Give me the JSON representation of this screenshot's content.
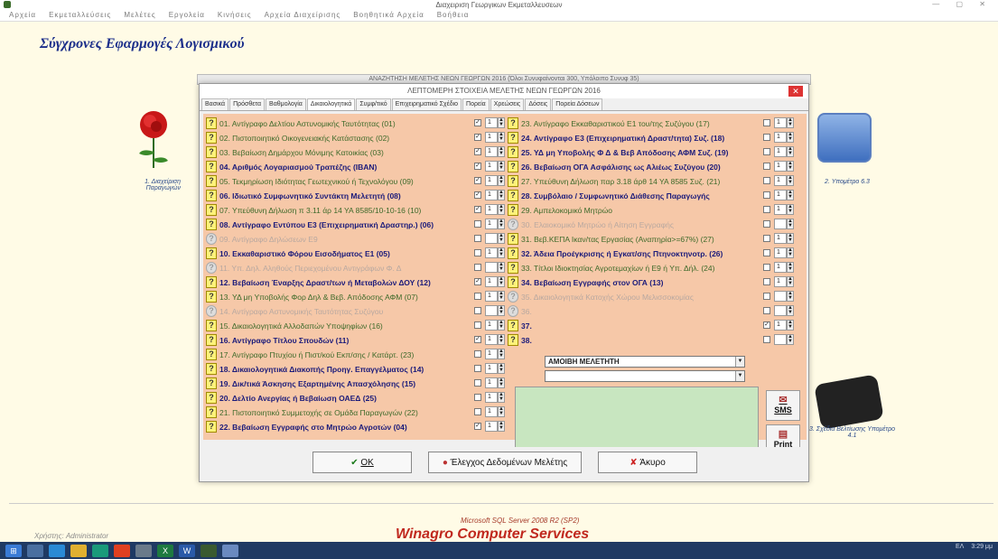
{
  "window": {
    "title": "Διαχειριση Γεωργικων Εκμεταλλευσεων"
  },
  "menu": [
    "Αρχεία",
    "Εκμεταλλεύσεις",
    "Μελέτες",
    "Εργολεία",
    "Κινήσεις",
    "Αρχεία Διαχείρισης",
    "Βοηθητικά Αρχεία",
    "Βοήθεια"
  ],
  "app": {
    "title": "Σύγχρονες Εφαρμογές Λογισμικού"
  },
  "tiles": {
    "left": "1. Διαχείριση Παραγωγών",
    "right": "2. Υπομέτρο 6.3",
    "phone": "3. Σχέδια Βελτίωσης Υπομέτρο 4.1"
  },
  "bg_window": {
    "title": "ΑΝΑΖΗΤΗΣΗ ΜΕΛΕΤΗΣ ΝΕΩΝ ΓΕΩΡΓΩΝ 2016 (Όλοι Συνυφαίνονται 300, Υπόλοιπο Συνυφ 35)"
  },
  "dialog": {
    "title": "ΛΕΠΤΟΜΕΡΗ ΣΤΟΙΧΕΙΑ ΜΕΛΕΤΗΣ ΝΕΩΝ ΓΕΩΡΓΩΝ 2016",
    "tabs": [
      "Βασικά",
      "Πρόσθετα",
      "Βαθμολογία",
      "Δικαιολογητικά",
      "Συμφ/τικό",
      "Επιχειρηματικό Σχέδιο",
      "Πορεία",
      "Χρεώσεις",
      "Δόσεις",
      "Πορεία Δόσεων"
    ],
    "left": [
      {
        "label": "01. Αντίγραφο Δελτίου Αστυνομικής Ταυτότητας (01)",
        "style": "green",
        "checked": true,
        "n": "1"
      },
      {
        "label": "02. Πιστοποιητικό Οικογενειακής Κατάστασης (02)",
        "style": "green",
        "checked": true,
        "n": "1"
      },
      {
        "label": "03. Βεβαίωση Δημάρχου Μόνιμης Κατοικίας (03)",
        "style": "green",
        "checked": true,
        "n": "1"
      },
      {
        "label": "04. Αριθμός Λογαριασμού Τραπέζης (IBAN)",
        "style": "bold",
        "checked": true,
        "n": "1"
      },
      {
        "label": "05. Τεκμηρίωση Ιδιότητας Γεωτεχνικού ή Τεχνολόγου (09)",
        "style": "green",
        "checked": true,
        "n": "1"
      },
      {
        "label": "06. Ιδιωτικό Συμφωνητικό Συντάκτη Μελετητή (08)",
        "style": "bold",
        "checked": true,
        "n": "1"
      },
      {
        "label": "07. Υπεύθυνη Δήλωση π 3.11 άρ 14 ΥΑ 8585/10-10-16 (10)",
        "style": "green",
        "checked": true,
        "n": "1"
      },
      {
        "label": "08. Αντίγραφο Εντύπου Ε3 (Επιχειρηματική Δραστηρ.) (06)",
        "style": "bold",
        "checked": false,
        "n": "1"
      },
      {
        "label": "09. Αντίγραφο Δηλώσεων Ε9",
        "style": "dis",
        "checked": false,
        "n": ""
      },
      {
        "label": "10. Εκκαθαριστικό Φόρου Εισοδήματος Ε1 (05)",
        "style": "bold",
        "checked": false,
        "n": "1"
      },
      {
        "label": "11. Υπ. Δηλ. Αληθούς Περιεχομένου Αντιγράφων Φ. Δ",
        "style": "dis",
        "checked": false,
        "n": ""
      },
      {
        "label": "12. Βεβαίωση Έναρξης Δραστ/των ή Μεταβολών ΔΟΥ (12)",
        "style": "bold",
        "checked": true,
        "n": "1"
      },
      {
        "label": "13. ΥΔ μη Υποβολής Φορ Δηλ & Βεβ. Απόδοσης ΑΦΜ (07)",
        "style": "green",
        "checked": false,
        "n": "1"
      },
      {
        "label": "14. Αντίγραφο Αστυνομικής Ταυτότητας Συζύγου",
        "style": "dis",
        "checked": false,
        "n": ""
      },
      {
        "label": "15. Δικαιολογητικά Αλλοδαπών Υποψηφίων (16)",
        "style": "green",
        "checked": false,
        "n": "1"
      },
      {
        "label": "16. Αντίγραφο Τίτλου Σπουδών (11)",
        "style": "bold",
        "checked": true,
        "n": "1"
      },
      {
        "label": "17. Αντίγραφο Πτυχίου ή Πιστ/κού Εκπ/σης / Κατάρτ. (23)",
        "style": "green",
        "checked": false,
        "n": "1"
      },
      {
        "label": "18. Δικαιολογητικά Διακοπής Προηγ. Επαγγέλματος (14)",
        "style": "bold",
        "checked": false,
        "n": "1"
      },
      {
        "label": "19. Δικ/τικά Άσκησης Εξαρτημένης Απασχόλησης (15)",
        "style": "bold",
        "checked": false,
        "n": "1"
      },
      {
        "label": "20. Δελτίο Ανεργίας ή Βεβαίωση ΟΑΕΔ (25)",
        "style": "bold",
        "checked": false,
        "n": "1"
      },
      {
        "label": "21. Πιστοποιητικό Συμμετοχής σε Ομάδα Παραγωγών (22)",
        "style": "green",
        "checked": false,
        "n": "1"
      },
      {
        "label": "22. Βεβαίωση Εγγραφής στο Μητρώο Αγροτών (04)",
        "style": "bold",
        "checked": true,
        "n": "1"
      }
    ],
    "right": [
      {
        "label": "23. Αντίγραφο Εκκαθαριστικού Ε1 του/της Συζύγου (17)",
        "style": "green",
        "checked": false,
        "n": "1"
      },
      {
        "label": "24. Αντίγραφο Ε3 (Επιχειρηματική Δραστ/τητα) Συζ. (18)",
        "style": "bold",
        "checked": false,
        "n": "1"
      },
      {
        "label": "25. ΥΔ μη Υποβολής Φ Δ & Βεβ Απόδοσης ΑΦΜ Συζ. (19)",
        "style": "bold",
        "checked": false,
        "n": "1"
      },
      {
        "label": "26. Βεβαίωση ΟΓΑ Ασφάλισης ως Αλιέως Συζύγου (20)",
        "style": "bold",
        "checked": false,
        "n": "1"
      },
      {
        "label": "27. Υπεύθυνη Δήλωση παρ 3.18 άρθ 14 ΥΑ 8585 Συζ. (21)",
        "style": "green",
        "checked": false,
        "n": "1"
      },
      {
        "label": "28. Συμβόλαιο / Συμφωνητικό Διάθεσης Παραγωγής",
        "style": "bold",
        "checked": false,
        "n": "1"
      },
      {
        "label": "29. Αμπελοκομικό Μητρώο",
        "style": "green",
        "checked": false,
        "n": "1"
      },
      {
        "label": "30. Ελαιοκομικό Μητρώο ή Αίτηση Εγγραφής",
        "style": "dis",
        "checked": false,
        "n": ""
      },
      {
        "label": "31. Βεβ.ΚΕΠΑ Ικαν/τας Εργασίας (Αναπηρία>=67%) (27)",
        "style": "green",
        "checked": false,
        "n": "1"
      },
      {
        "label": "32. Άδεια Προέγκρισης ή Εγκατ/σης Πτηνοκτηνοτρ. (26)",
        "style": "bold",
        "checked": false,
        "n": "1"
      },
      {
        "label": "33. Τίτλοι Ιδιοκτησίας Αγροτεμαχίων ή Ε9 ή Υπ. Δήλ. (24)",
        "style": "green",
        "checked": false,
        "n": "1"
      },
      {
        "label": "34. Βεβαίωση Εγγραφής στον ΟΓΑ (13)",
        "style": "bold",
        "checked": false,
        "n": "1"
      },
      {
        "label": "35. Δικαιολογητικά Κατοχής Χώρου Μελισσοκομίας",
        "style": "dis",
        "checked": false,
        "n": ""
      },
      {
        "label": "36.",
        "style": "dis",
        "checked": false,
        "n": ""
      },
      {
        "label": "37.",
        "style": "bold",
        "checked": true,
        "n": "1"
      },
      {
        "label": "38.",
        "style": "bold",
        "checked": false,
        "n": ""
      }
    ],
    "combo37": "ΑΜΟΙΒΗ ΜΕΛΕΤΗΤΗ",
    "sms_label": "SMS",
    "print_label": "Print",
    "ok_label": "OK",
    "check_label": "Έλεγχος Δεδομένων Μελέτης",
    "cancel_label": "Άκυρο"
  },
  "footer": {
    "sql": "Microsoft SQL Server 2008 R2 (SP2)",
    "company": "Winagro Computer Services",
    "user": "Χρήστης: Administrator"
  },
  "tray": {
    "lang": "ΕΛ",
    "time": "3:29 μμ"
  }
}
